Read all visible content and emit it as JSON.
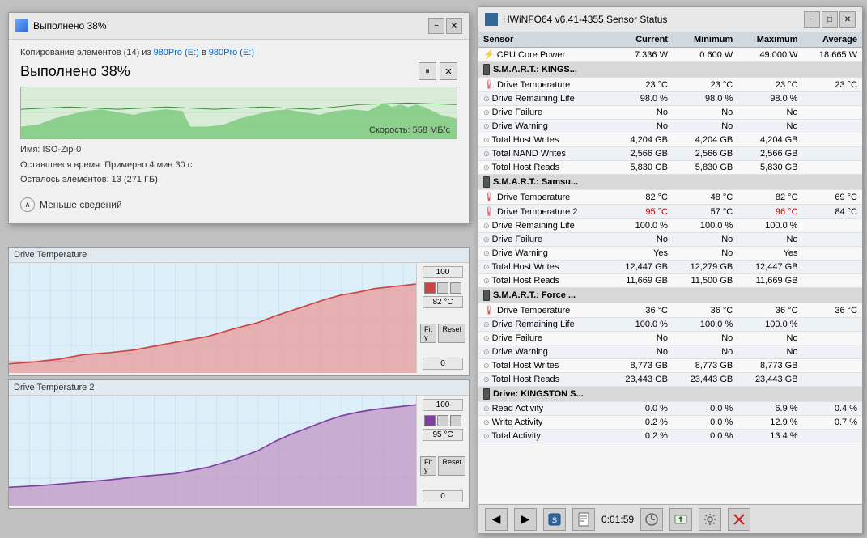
{
  "copy_dialog": {
    "title": "Выполнено 38%",
    "subtitle": "Копирование элементов (14) из",
    "subtitle_from": "980Pro (E:)",
    "subtitle_to": "980Pro (E:)",
    "main_title": "Выполнено 38%",
    "speed_label": "Скорость: 558 МБ/с",
    "name_label": "Имя: ISO-Zip-0",
    "time_label": "Оставшееся время: Примерно 4 мин 30 с",
    "items_label": "Осталось элементов: 13 (271 ГБ)",
    "expand_label": "Меньше сведений",
    "progress_pct": 38
  },
  "chart1": {
    "title": "Drive Temperature",
    "max_val": "100",
    "current_val": "82 °C",
    "min_val": "0",
    "fit_label": "Fit y",
    "reset_label": "Reset",
    "color": "#e07070"
  },
  "chart2": {
    "title": "Drive Temperature 2",
    "max_val": "100",
    "current_val": "95 °C",
    "min_val": "0",
    "fit_label": "Fit y",
    "reset_label": "Reset",
    "color": "#9070a0"
  },
  "hwinfo": {
    "title": "HWiNFO64 v6.41-4355 Sensor Status",
    "columns": [
      "Sensor",
      "Current",
      "Minimum",
      "Maximum",
      "Average"
    ],
    "rows": [
      {
        "type": "data",
        "icon": "cpu",
        "sensor": "CPU Core Power",
        "current": "7.336 W",
        "minimum": "0.600 W",
        "maximum": "49.000 W",
        "average": "18.665 W"
      },
      {
        "type": "section",
        "sensor": "S.M.A.R.T.: KINGS...",
        "current": "",
        "minimum": "",
        "maximum": "",
        "average": ""
      },
      {
        "type": "data",
        "icon": "temp",
        "sensor": "Drive Temperature",
        "current": "23 °C",
        "minimum": "23 °C",
        "maximum": "23 °C",
        "average": "23 °C"
      },
      {
        "type": "data",
        "icon": "circle",
        "sensor": "Drive Remaining Life",
        "current": "98.0 %",
        "minimum": "98.0 %",
        "maximum": "98.0 %",
        "average": ""
      },
      {
        "type": "data",
        "icon": "circle",
        "sensor": "Drive Failure",
        "current": "No",
        "minimum": "No",
        "maximum": "No",
        "average": ""
      },
      {
        "type": "data",
        "icon": "circle",
        "sensor": "Drive Warning",
        "current": "No",
        "minimum": "No",
        "maximum": "No",
        "average": ""
      },
      {
        "type": "data",
        "icon": "circle",
        "sensor": "Total Host Writes",
        "current": "4,204 GB",
        "minimum": "4,204 GB",
        "maximum": "4,204 GB",
        "average": ""
      },
      {
        "type": "data",
        "icon": "circle",
        "sensor": "Total NAND Writes",
        "current": "2,566 GB",
        "minimum": "2,566 GB",
        "maximum": "2,566 GB",
        "average": ""
      },
      {
        "type": "data",
        "icon": "circle",
        "sensor": "Total Host Reads",
        "current": "5,830 GB",
        "minimum": "5,830 GB",
        "maximum": "5,830 GB",
        "average": ""
      },
      {
        "type": "section",
        "sensor": "S.M.A.R.T.: Samsu...",
        "current": "",
        "minimum": "",
        "maximum": "",
        "average": ""
      },
      {
        "type": "data",
        "icon": "temp",
        "sensor": "Drive Temperature",
        "current": "82 °C",
        "minimum": "48 °C",
        "maximum": "82 °C",
        "average": "69 °C"
      },
      {
        "type": "data",
        "icon": "temp",
        "sensor": "Drive Temperature 2",
        "current_red": "95 °C",
        "minimum": "57 °C",
        "maximum_red": "96 °C",
        "average": "84 °C"
      },
      {
        "type": "data",
        "icon": "circle",
        "sensor": "Drive Remaining Life",
        "current": "100.0 %",
        "minimum": "100.0 %",
        "maximum": "100.0 %",
        "average": ""
      },
      {
        "type": "data",
        "icon": "circle",
        "sensor": "Drive Failure",
        "current": "No",
        "minimum": "No",
        "maximum": "No",
        "average": ""
      },
      {
        "type": "data",
        "icon": "circle",
        "sensor": "Drive Warning",
        "current": "Yes",
        "minimum": "No",
        "maximum": "Yes",
        "average": ""
      },
      {
        "type": "data",
        "icon": "circle",
        "sensor": "Total Host Writes",
        "current": "12,447 GB",
        "minimum": "12,279 GB",
        "maximum": "12,447 GB",
        "average": ""
      },
      {
        "type": "data",
        "icon": "circle",
        "sensor": "Total Host Reads",
        "current": "11,669 GB",
        "minimum": "11,500 GB",
        "maximum": "11,669 GB",
        "average": ""
      },
      {
        "type": "section",
        "sensor": "S.M.A.R.T.: Force ...",
        "current": "",
        "minimum": "",
        "maximum": "",
        "average": ""
      },
      {
        "type": "data",
        "icon": "temp",
        "sensor": "Drive Temperature",
        "current": "36 °C",
        "minimum": "36 °C",
        "maximum": "36 °C",
        "average": "36 °C"
      },
      {
        "type": "data",
        "icon": "circle",
        "sensor": "Drive Remaining Life",
        "current": "100.0 %",
        "minimum": "100.0 %",
        "maximum": "100.0 %",
        "average": ""
      },
      {
        "type": "data",
        "icon": "circle",
        "sensor": "Drive Failure",
        "current": "No",
        "minimum": "No",
        "maximum": "No",
        "average": ""
      },
      {
        "type": "data",
        "icon": "circle",
        "sensor": "Drive Warning",
        "current": "No",
        "minimum": "No",
        "maximum": "No",
        "average": ""
      },
      {
        "type": "data",
        "icon": "circle",
        "sensor": "Total Host Writes",
        "current": "8,773 GB",
        "minimum": "8,773 GB",
        "maximum": "8,773 GB",
        "average": ""
      },
      {
        "type": "data",
        "icon": "circle",
        "sensor": "Total Host Reads",
        "current": "23,443 GB",
        "minimum": "23,443 GB",
        "maximum": "23,443 GB",
        "average": ""
      },
      {
        "type": "section",
        "sensor": "Drive: KINGSTON S...",
        "current": "",
        "minimum": "",
        "maximum": "",
        "average": ""
      },
      {
        "type": "data",
        "icon": "circle",
        "sensor": "Read Activity",
        "current": "0.0 %",
        "minimum": "0.0 %",
        "maximum": "6.9 %",
        "average": "0.4 %"
      },
      {
        "type": "data",
        "icon": "circle",
        "sensor": "Write Activity",
        "current": "0.2 %",
        "minimum": "0.0 %",
        "maximum": "12.9 %",
        "average": "0.7 %"
      },
      {
        "type": "data",
        "icon": "circle",
        "sensor": "Total Activity",
        "current": "0.2 %",
        "minimum": "0.0 %",
        "maximum": "13.4 %",
        "average": ""
      }
    ],
    "statusbar": {
      "time": "0:01:59"
    }
  }
}
